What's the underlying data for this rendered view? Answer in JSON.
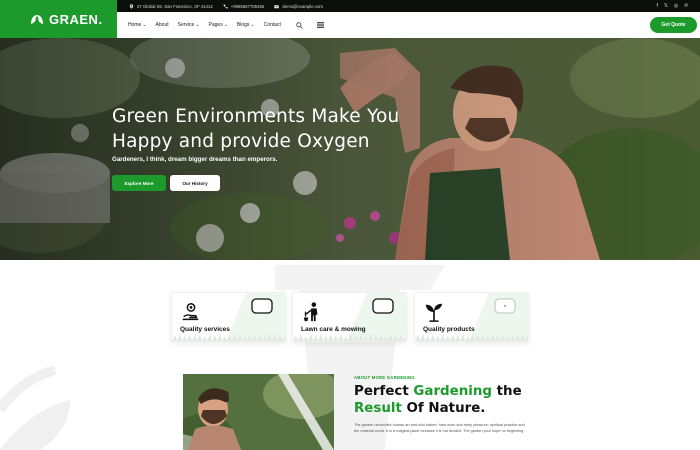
{
  "brand": {
    "name": "GRAEN.",
    "logo_icon": "leaf-icon",
    "accent": "#1c9a2b"
  },
  "topbar": {
    "address": "27 Global Str, San Francisco, SF 41412",
    "phone": "+9995567765455",
    "email": "demo@example.com",
    "socials": [
      "facebook-icon",
      "x-icon",
      "instagram-icon",
      "pinterest-icon"
    ]
  },
  "nav": {
    "items": [
      {
        "label": "Home",
        "dropdown": true
      },
      {
        "label": "About",
        "dropdown": false
      },
      {
        "label": "Service",
        "dropdown": true
      },
      {
        "label": "Pages",
        "dropdown": true
      },
      {
        "label": "Blogs",
        "dropdown": true
      },
      {
        "label": "Contact",
        "dropdown": false
      }
    ],
    "dropdown_glyph": "⌄",
    "cta": "Get Quote"
  },
  "hero": {
    "title_line1": "Green Environments Make You",
    "title_line2": "Happy and provide Oxygen",
    "subtitle": "Gardeners, I think, dream bigger dreams than emperors.",
    "btn_primary": "Explore More",
    "btn_secondary": "Our History"
  },
  "services": [
    {
      "label": "Quality services",
      "icon": "hand-plant-icon"
    },
    {
      "label": "Lawn care & mowing",
      "icon": "gardener-icon"
    },
    {
      "label": "Quality products",
      "icon": "sprout-icon"
    }
  ],
  "about": {
    "kicker": "ABOUT MORE GARDENING",
    "title_a": "Perfect ",
    "title_b": "Gardening",
    "title_c": " the",
    "title_d": "Result",
    "title_e": " Of Nature.",
    "body": "The garden reconciles human art and wild nature; hard work and deep pleasure; spiritual practice and the material world. It is a magical place because it is not divided. The garden your hope no beginning."
  }
}
